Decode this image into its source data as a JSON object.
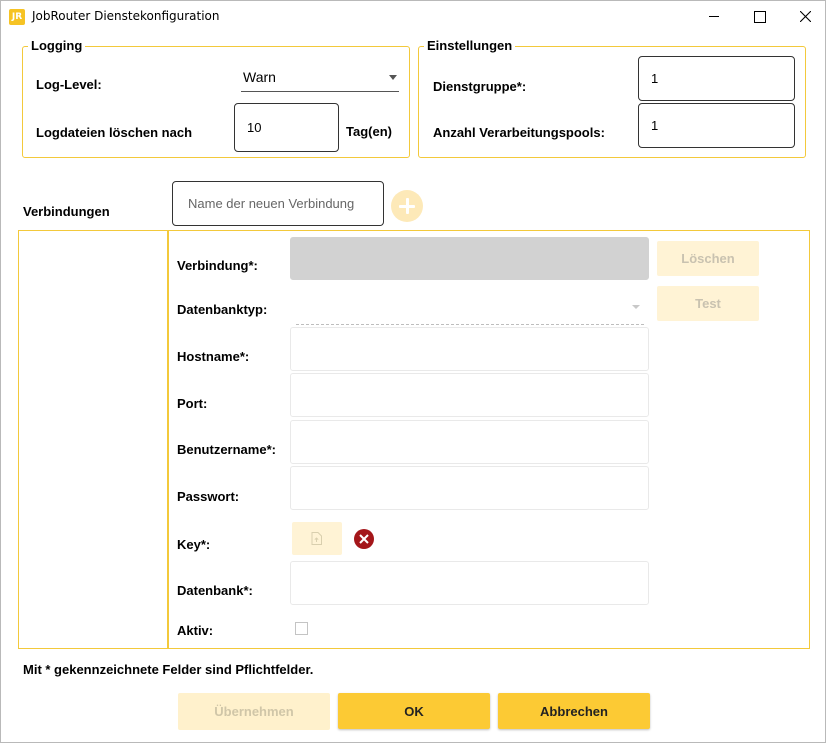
{
  "window": {
    "title": "JobRouter Dienstekonfiguration",
    "icon_text": "JR"
  },
  "logging": {
    "group_title": "Logging",
    "log_level_label": "Log-Level:",
    "log_level_value": "Warn",
    "delete_label": "Logdateien löschen nach",
    "delete_value": "10",
    "delete_unit": "Tag(en)"
  },
  "settings": {
    "group_title": "Einstellungen",
    "service_group_label": "Dienstgruppe*:",
    "service_group_value": "1",
    "pools_label": "Anzahl Verarbeitungspools:",
    "pools_value": "1"
  },
  "connections": {
    "label": "Verbindungen",
    "new_placeholder": "Name der neuen Verbindung",
    "add_icon": "plus-circle-icon"
  },
  "form": {
    "connection_label": "Verbindung*:",
    "dbtype_label": "Datenbanktyp:",
    "hostname_label": "Hostname*:",
    "port_label": "Port:",
    "username_label": "Benutzername*:",
    "password_label": "Passwort:",
    "key_label": "Key*:",
    "database_label": "Datenbank*:",
    "active_label": "Aktiv:",
    "delete_button": "Löschen",
    "test_button": "Test"
  },
  "footer": {
    "note": "Mit * gekennzeichnete Felder sind Pflichtfelder.",
    "apply_button": "Übernehmen",
    "ok_button": "OK",
    "cancel_button": "Abbrechen"
  },
  "colors": {
    "accent": "#fcca34",
    "border": "#f3c93b",
    "remove": "#a4161a"
  }
}
